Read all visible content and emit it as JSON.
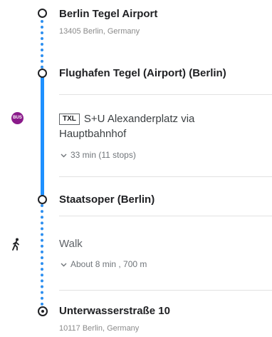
{
  "origin": {
    "name": "Berlin Tegel Airport",
    "address": "13405 Berlin, Germany"
  },
  "stops": {
    "board": "Flughafen Tegel (Airport) (Berlin)",
    "alight": "Staatsoper (Berlin)"
  },
  "transit": {
    "icon": "bus-icon",
    "icon_text": "BUS",
    "route_badge": "TXL",
    "description": "S+U Alexanderplatz via Hauptbahnhof",
    "duration": "33 min (11 stops)",
    "line_color": "#1e90ff"
  },
  "walk": {
    "icon": "walk-icon",
    "label": "Walk",
    "detail": "About 8 min , 700 m"
  },
  "destination": {
    "name": "Unterwasserstraße 10",
    "address": "10117 Berlin, Germany"
  }
}
